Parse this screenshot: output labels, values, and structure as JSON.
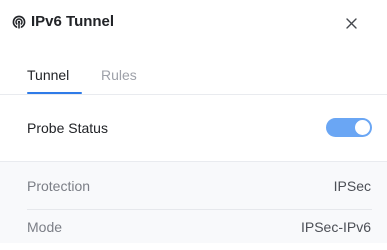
{
  "header": {
    "title": "IPv6 Tunnel",
    "title_icon": "broadcast-signal-icon",
    "close_icon": "close-icon"
  },
  "tabs": [
    {
      "label": "Tunnel",
      "active": true
    },
    {
      "label": "Rules",
      "active": false
    }
  ],
  "probe": {
    "label": "Probe Status",
    "enabled": true
  },
  "details": [
    {
      "label": "Protection",
      "value": "IPSec"
    },
    {
      "label": "Mode",
      "value": "IPSec-IPv6"
    }
  ],
  "colors": {
    "accent": "#2f7be8",
    "toggle_on": "#6aa6f4",
    "text": "#212327",
    "muted_text": "#9ea1a9",
    "section_bg": "#f8f9fb"
  }
}
